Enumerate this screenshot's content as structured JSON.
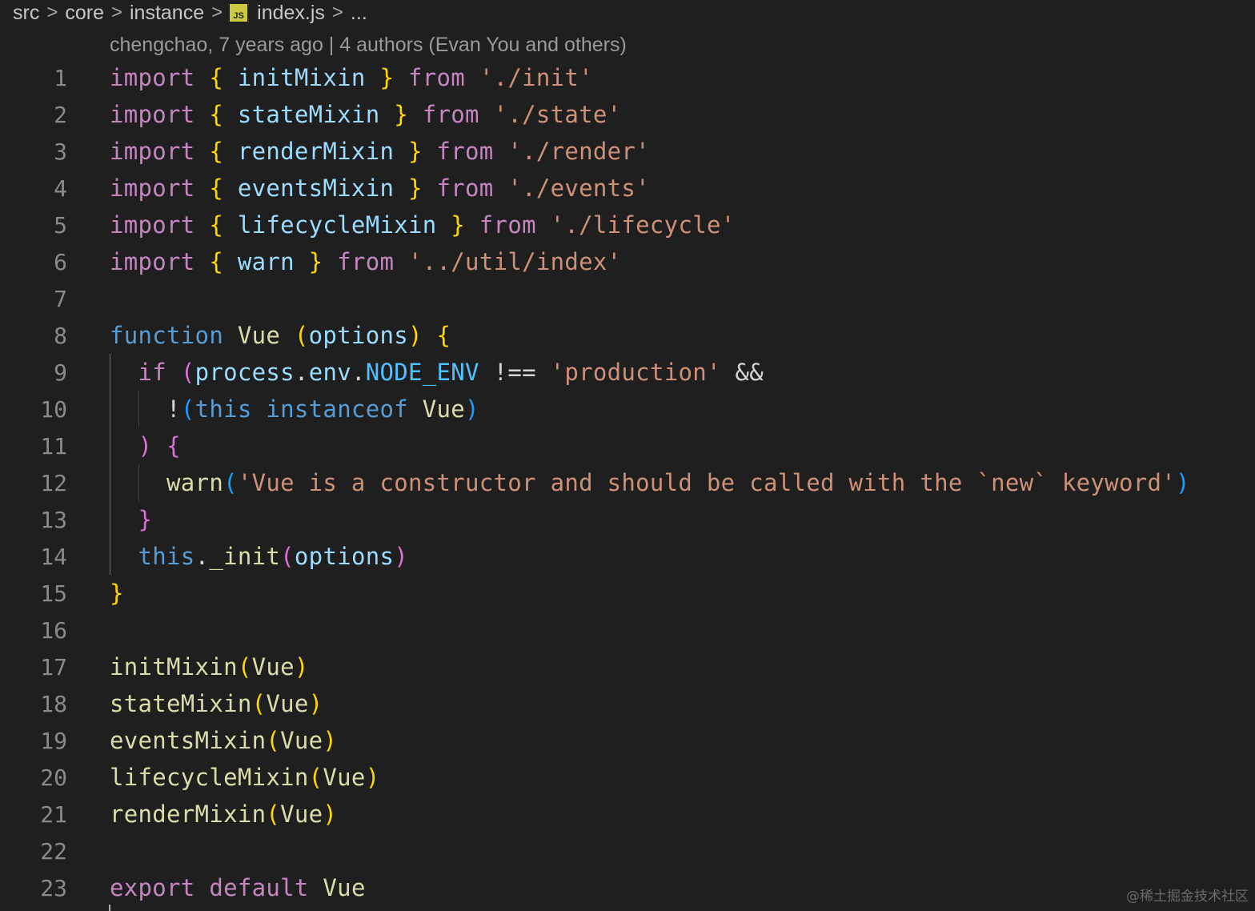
{
  "breadcrumb": {
    "items": [
      "src",
      "core",
      "instance",
      "index.js",
      "..."
    ],
    "file_icon": "JS"
  },
  "blame": {
    "text": "chengchao, 7 years ago | 4 authors (Evan You and others)"
  },
  "editor": {
    "line_numbers": [
      "1",
      "2",
      "3",
      "4",
      "5",
      "6",
      "7",
      "8",
      "9",
      "10",
      "11",
      "12",
      "13",
      "14",
      "15",
      "16",
      "17",
      "18",
      "19",
      "20",
      "21",
      "22",
      "23"
    ]
  },
  "watermark": "@稀土掘金技术社区",
  "colors": {
    "background": "#1f1f1f",
    "keyword": "#c586c0",
    "storage": "#569cd6",
    "variable": "#9cdcfe",
    "function": "#dcdcaa",
    "string": "#ce9178",
    "bracket1": "#ffd700",
    "bracket2": "#da70d6",
    "bracket3": "#179fff"
  }
}
